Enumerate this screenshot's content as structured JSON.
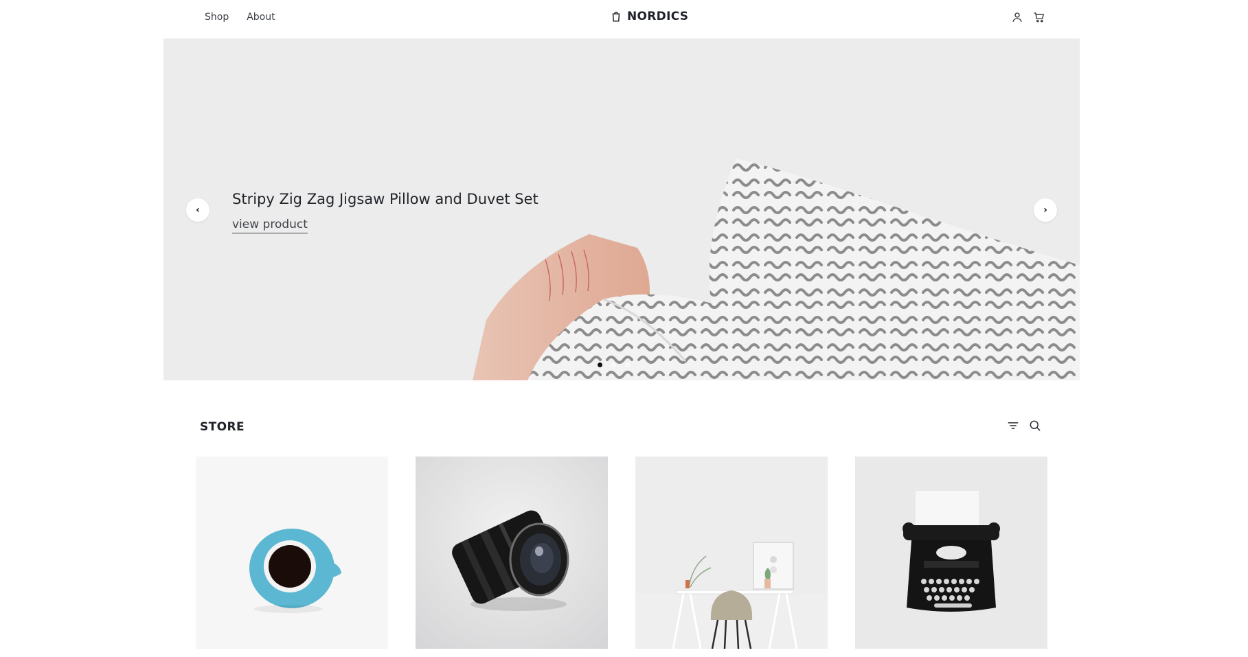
{
  "header": {
    "nav": [
      "Shop",
      "About"
    ],
    "brand": "NORDICS",
    "icons": [
      "user-icon",
      "cart-icon"
    ]
  },
  "hero": {
    "title": "Stripy Zig Zag Jigsaw Pillow and Duvet Set",
    "link_label": "view product",
    "prev_icon": "chevron-left-icon",
    "next_icon": "chevron-right-icon",
    "slide_count": 3,
    "active_slide": 1
  },
  "store": {
    "title": "STORE",
    "tools": [
      "filter-icon",
      "search-icon"
    ],
    "products": [
      {
        "image": "coffee-cup"
      },
      {
        "image": "camera-lens"
      },
      {
        "image": "desk-chair"
      },
      {
        "image": "typewriter"
      }
    ]
  },
  "colors": {
    "text": "#1f2328",
    "hero_bg": "#ebebeb",
    "accent": "#111111"
  }
}
